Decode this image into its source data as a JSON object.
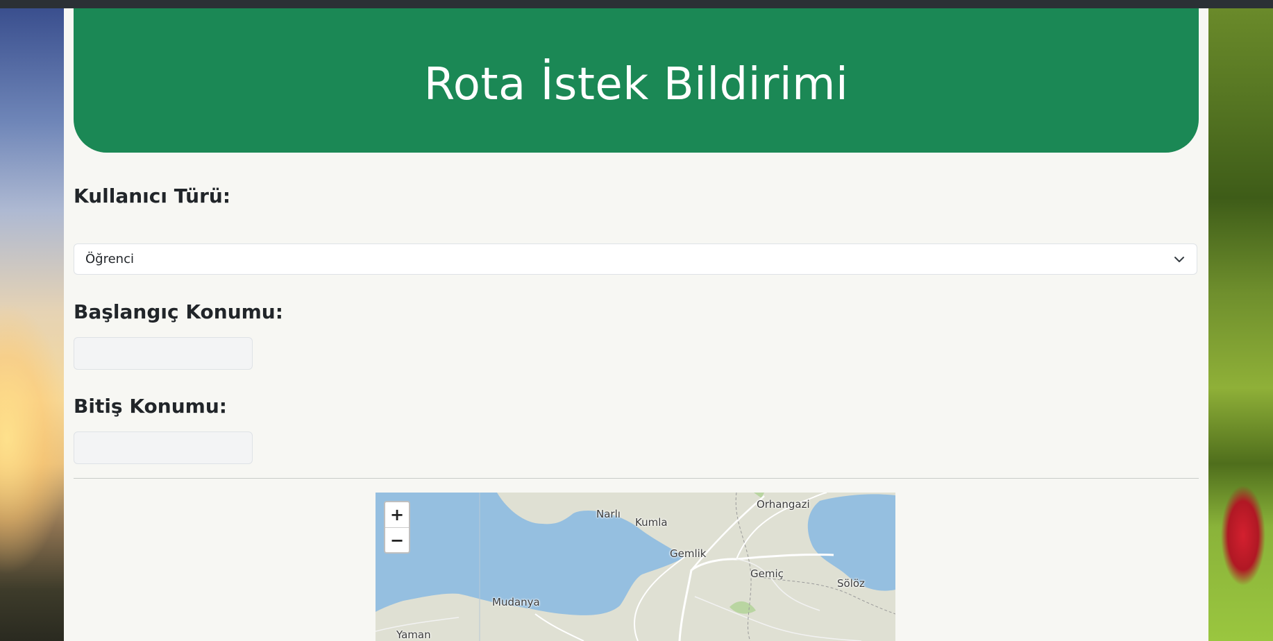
{
  "header": {
    "title": "Rota İstek Bildirimi"
  },
  "form": {
    "user_type_label": "Kullanıcı Türü:",
    "user_type_value": "Öğrenci",
    "start_label": "Başlangıç Konumu:",
    "start_value": "",
    "end_label": "Bitiş Konumu:",
    "end_value": ""
  },
  "map": {
    "zoom_in": "+",
    "zoom_out": "−",
    "places": [
      "Orhangazi",
      "Narlı",
      "Kumla",
      "Gemlik",
      "Gemiç",
      "Sölöz",
      "Mudanya",
      "Yaman"
    ]
  },
  "colors": {
    "header_bg": "#1b8855",
    "page_bg": "#f7f7f3",
    "water": "#95bfe0",
    "land": "#dfe0d3"
  },
  "icons": {
    "select_caret": "chevron-down-icon"
  }
}
